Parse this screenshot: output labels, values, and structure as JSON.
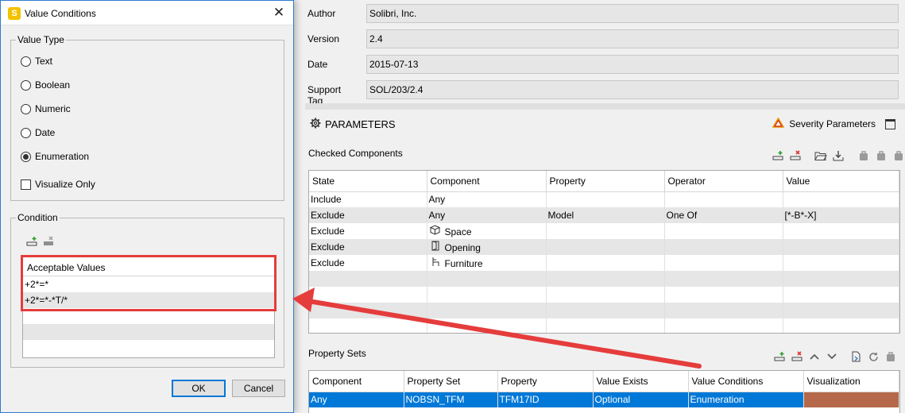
{
  "dialog": {
    "title": "Value Conditions",
    "app_icon_letter": "S",
    "value_type": {
      "legend": "Value Type",
      "options": [
        "Text",
        "Boolean",
        "Numeric",
        "Date",
        "Enumeration"
      ],
      "selected": "Enumeration",
      "visualize_only_label": "Visualize Only"
    },
    "condition": {
      "legend": "Condition",
      "list_header": "Acceptable Values",
      "values": [
        "+2*=*",
        "+2*=*-*T/*"
      ]
    },
    "ok_label": "OK",
    "cancel_label": "Cancel"
  },
  "info": {
    "author_label": "Author",
    "author_value": "Solibri, Inc.",
    "version_label": "Version",
    "version_value": "2.4",
    "date_label": "Date",
    "date_value": "2015-07-13",
    "support_label": "Support Tag",
    "support_value": "SOL/203/2.4"
  },
  "parameters": {
    "title": "PARAMETERS",
    "severity_label": "Severity Parameters"
  },
  "checked_components": {
    "title": "Checked Components",
    "columns": [
      "State",
      "Component",
      "Property",
      "Operator",
      "Value"
    ],
    "rows": [
      {
        "state": "Include",
        "component": "Any",
        "icon": "",
        "property": "",
        "operator": "",
        "value": ""
      },
      {
        "state": "Exclude",
        "component": "Any",
        "icon": "",
        "property": "Model",
        "operator": "One Of",
        "value": "[*-B*-X]"
      },
      {
        "state": "Exclude",
        "component": "Space",
        "icon": "cube-icon",
        "property": "",
        "operator": "",
        "value": ""
      },
      {
        "state": "Exclude",
        "component": "Opening",
        "icon": "door-icon",
        "property": "",
        "operator": "",
        "value": ""
      },
      {
        "state": "Exclude",
        "component": "Furniture",
        "icon": "chair-icon",
        "property": "",
        "operator": "",
        "value": ""
      }
    ]
  },
  "property_sets": {
    "title": "Property Sets",
    "columns": [
      "Component",
      "Property Set",
      "Property",
      "Value Exists",
      "Value Conditions",
      "Visualization"
    ],
    "rows": [
      {
        "component": "Any",
        "property_set": "NOBSN_TFM",
        "property": "TFM17ID",
        "value_exists": "Optional",
        "value_conditions": "Enumeration",
        "visualization_color": "#b5694a"
      }
    ]
  },
  "colors": {
    "accent": "#0078d7",
    "annotation": "#e53c3c",
    "swatch": "#b5694a"
  }
}
